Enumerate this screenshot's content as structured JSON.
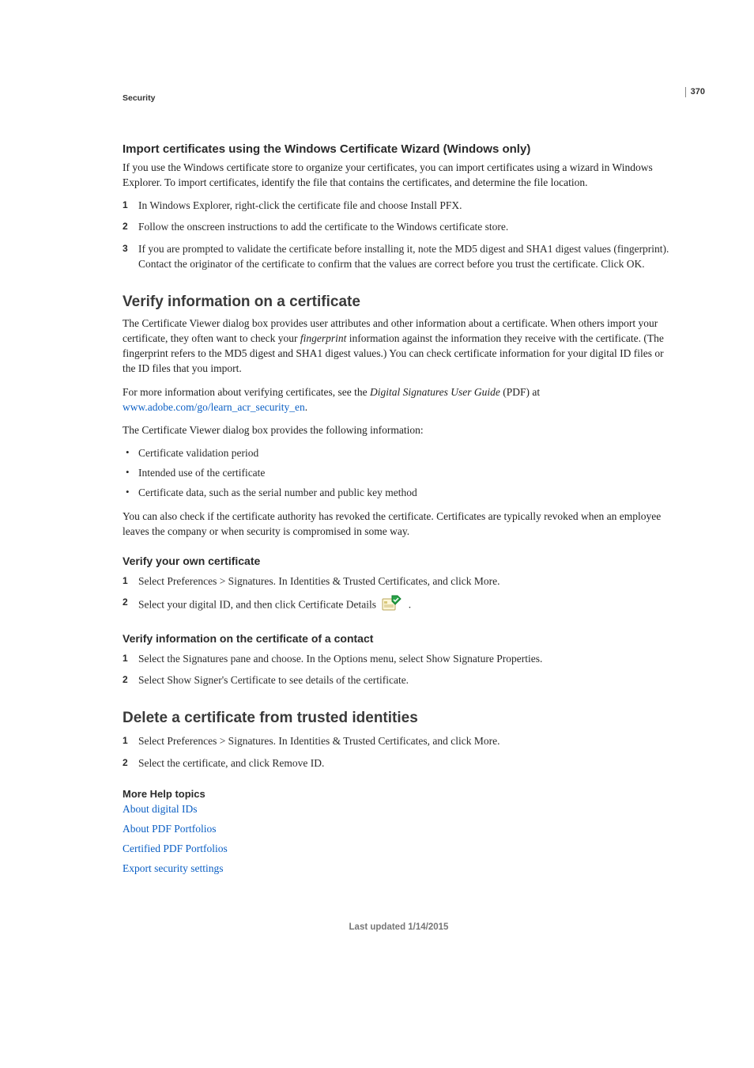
{
  "page_number": "370",
  "section_label": "Security",
  "s1": {
    "heading": "Import certificates using the Windows Certificate Wizard (Windows only)",
    "intro": "If you use the Windows certificate store to organize your certificates, you can import certificates using a wizard in Windows Explorer. To import certificates, identify the file that contains the certificates, and determine the file location.",
    "steps": [
      "In Windows Explorer, right-click the certificate file and choose Install PFX.",
      "Follow the onscreen instructions to add the certificate to the Windows certificate store.",
      "If you are prompted to validate the certificate before installing it, note the MD5 digest and SHA1 digest values (fingerprint). Contact the originator of the certificate to confirm that the values are correct before you trust the certificate. Click OK."
    ]
  },
  "s2": {
    "heading": "Verify information on a certificate",
    "p1a": "The Certificate Viewer dialog box provides user attributes and other information about a certificate. When others import your certificate, they often want to check your ",
    "p1_em": "fingerprint",
    "p1b": " information against the information they receive with the certificate. (The fingerprint refers to the MD5 digest and SHA1 digest values.) You can check certificate information for your digital ID files or the ID files that you import.",
    "p2a": "For more information about verifying certificates, see the ",
    "p2_em": "Digital Signatures User Guide",
    "p2b": " (PDF) at ",
    "p2_link": "www.adobe.com/go/learn_acr_security_en",
    "p2c": ".",
    "p3": "The Certificate Viewer dialog box provides the following information:",
    "bullets": [
      "Certificate validation period",
      "Intended use of the certificate",
      "Certificate data, such as the serial number and public key method"
    ],
    "p4": "You can also check if the certificate authority has revoked the certificate. Certificates are typically revoked when an employee leaves the company or when security is compromised in some way."
  },
  "s3": {
    "heading": "Verify your own certificate",
    "step1": "Select Preferences > Signatures. In Identities & Trusted Certificates, and click More.",
    "step2a": "Select your digital ID, and then click Certificate Details ",
    "step2b": "."
  },
  "s4": {
    "heading": "Verify information on the certificate of a contact",
    "steps": [
      "Select the Signatures pane and choose. In the Options menu, select Show Signature Properties.",
      "Select Show Signer's Certificate to see details of the certificate."
    ]
  },
  "s5": {
    "heading": "Delete a certificate from trusted identities",
    "steps": [
      "Select Preferences > Signatures. In Identities & Trusted Certificates, and click More.",
      "Select the certificate, and click Remove ID."
    ]
  },
  "more_help": {
    "heading": "More Help topics",
    "links": [
      "About digital IDs",
      "About PDF Portfolios",
      "Certified PDF Portfolios",
      "Export security settings"
    ]
  },
  "footer": "Last updated 1/14/2015"
}
